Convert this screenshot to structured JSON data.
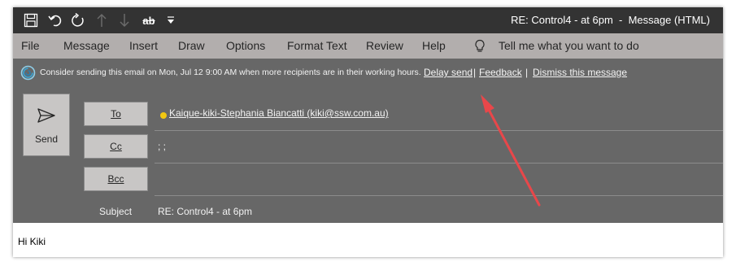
{
  "window": {
    "title": "RE: Control4 - at 6pm  -  Message (HTML)"
  },
  "quick_access": {
    "icons": [
      "save-icon",
      "undo-icon",
      "redo-icon",
      "previous-item-icon",
      "next-item-icon",
      "strikethrough-icon",
      "customize-dropdown-icon"
    ],
    "strike_text": "ab"
  },
  "ribbon": {
    "tabs": [
      {
        "label": "File"
      },
      {
        "label": "Message"
      },
      {
        "label": "Insert"
      },
      {
        "label": "Draw"
      },
      {
        "label": "Options"
      },
      {
        "label": "Format Text"
      },
      {
        "label": "Review"
      },
      {
        "label": "Help"
      }
    ],
    "tell_me": "Tell me what you want to do"
  },
  "infobar": {
    "message": "Consider sending this email on Mon, Jul 12 9:00 AM when more recipients are in their working hours.",
    "delay_send": "Delay send",
    "feedback": "Feedback",
    "separator": "|",
    "dismiss": "Dismiss this message"
  },
  "compose": {
    "send_label": "Send",
    "to_label": "To",
    "cc_label": "Cc",
    "bcc_label": "Bcc",
    "subject_label": "Subject",
    "to_value": "Kaique-kiki-Stephania Biancatti (kiki@ssw.com.au)",
    "cc_value": "; ;",
    "bcc_value": "",
    "subject_value": "RE: Control4 - at 6pm",
    "presence_color": "#f2c811"
  },
  "message_body": {
    "greeting": "Hi Kiki"
  },
  "annotation": {
    "arrow_color": "#e8474a"
  }
}
